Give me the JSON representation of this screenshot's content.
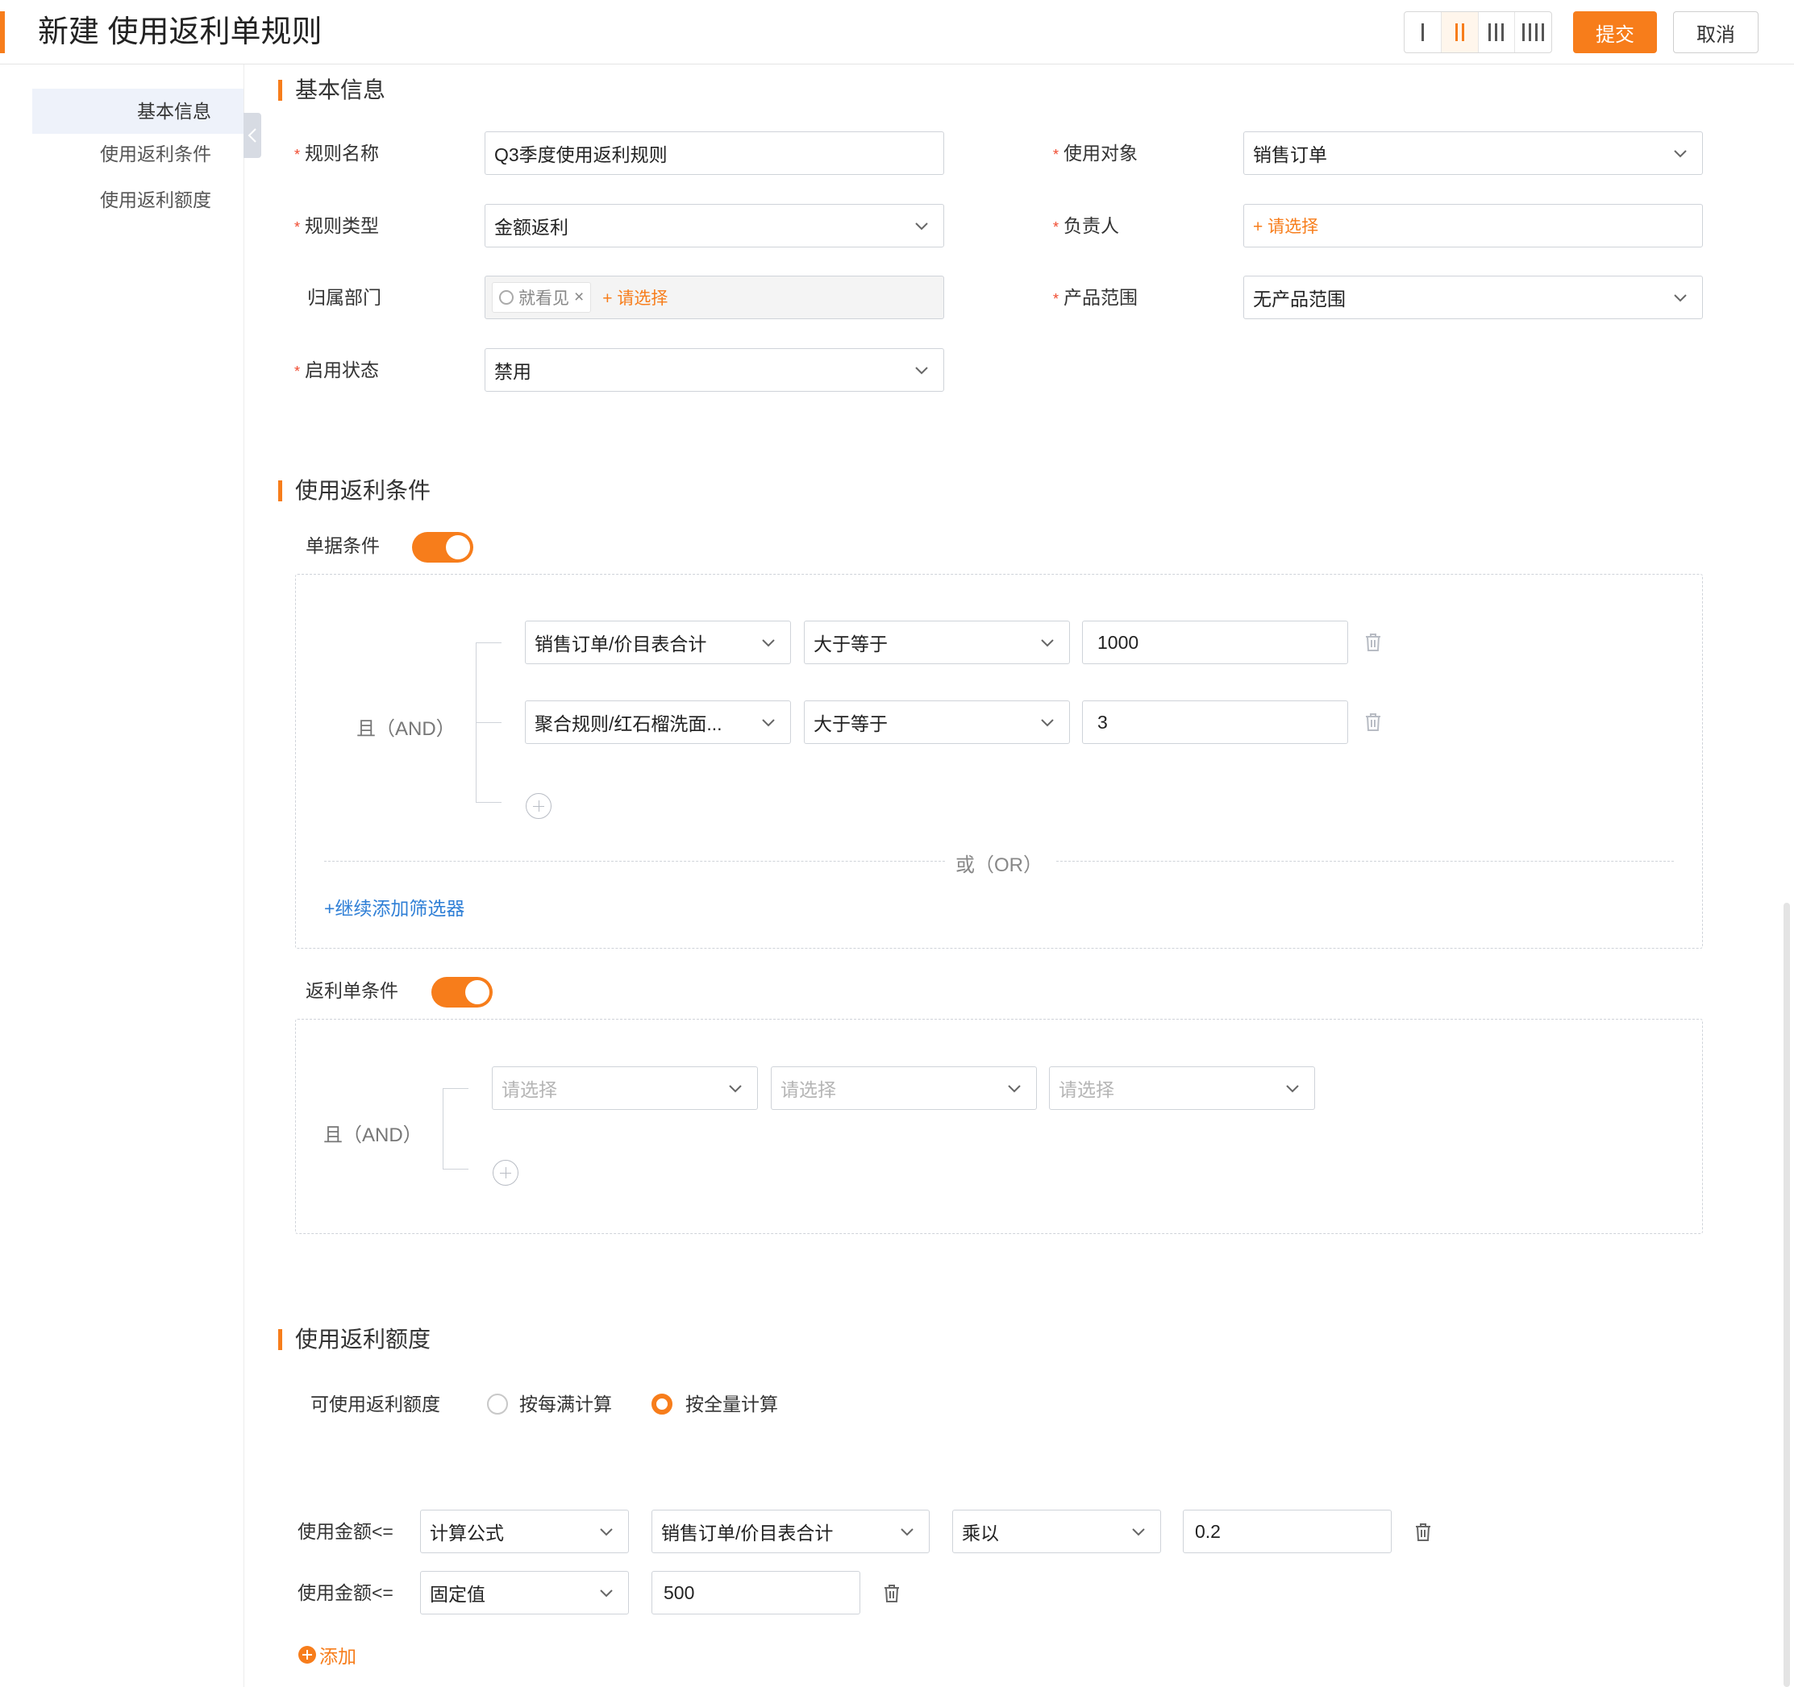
{
  "header": {
    "title": "新建 使用返利单规则",
    "submit_label": "提交",
    "cancel_label": "取消",
    "accent_color": "#f77d1b"
  },
  "sidebar": {
    "items": [
      {
        "label": "基本信息",
        "active": true
      },
      {
        "label": "使用返利条件",
        "active": false
      },
      {
        "label": "使用返利额度",
        "active": false
      }
    ]
  },
  "basic": {
    "section_title": "基本信息",
    "rule_name": {
      "label": "规则名称",
      "value": "Q3季度使用返利规则"
    },
    "target": {
      "label": "使用对象",
      "value": "销售订单"
    },
    "rule_type": {
      "label": "规则类型",
      "value": "金额返利"
    },
    "owner": {
      "label": "负责人",
      "value": "+ 请选择"
    },
    "department": {
      "label": "归属部门",
      "tag": "就看见",
      "tag_close": "×",
      "add": "+ 请选择"
    },
    "product_range": {
      "label": "产品范围",
      "value": "无产品范围"
    },
    "status": {
      "label": "启用状态",
      "value": "禁用"
    }
  },
  "conditions": {
    "section_title": "使用返利条件",
    "doc_condition_label": "单据条件",
    "and_label": "且（AND）",
    "rows": [
      {
        "field": "销售订单/价目表合计",
        "op": "大于等于",
        "value": "1000"
      },
      {
        "field": "聚合规则/红石榴洗面...",
        "op": "大于等于",
        "value": "3"
      }
    ],
    "or_label": "或（OR）",
    "add_filter": "+继续添加筛选器",
    "rebate_condition_label": "返利单条件",
    "rebate_and_label": "且（AND）",
    "rebate_row": {
      "field": "请选择",
      "op": "请选择",
      "value": "请选择"
    }
  },
  "quota": {
    "section_title": "使用返利额度",
    "label": "可使用返利额度",
    "option1": "按每满计算",
    "option2": "按全量计算",
    "selected": "按全量计算",
    "row1": {
      "label": "使用金额<=",
      "type": "计算公式",
      "field": "销售订单/价目表合计",
      "op": "乘以",
      "value": "0.2"
    },
    "row2": {
      "label": "使用金额<=",
      "type": "固定值",
      "value": "500"
    },
    "add_label": "添加"
  }
}
